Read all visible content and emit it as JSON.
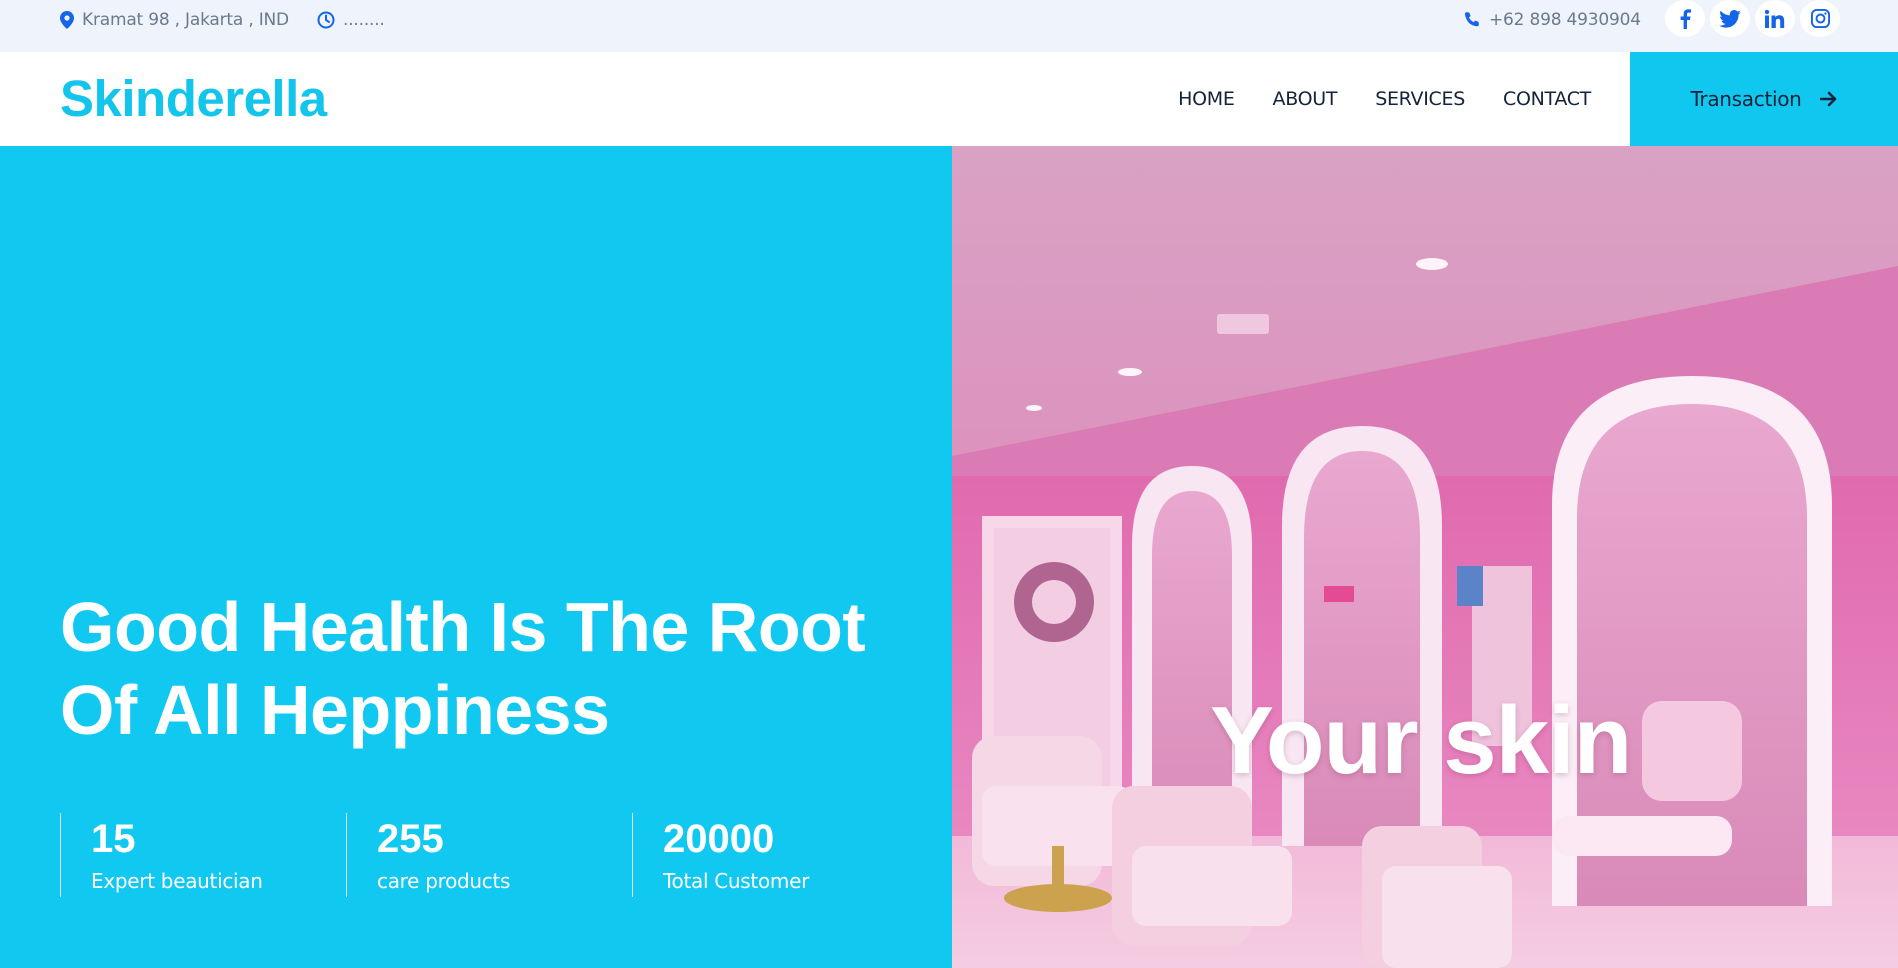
{
  "topbar": {
    "address": "Kramat 98 , Jakarta , IND",
    "hours": "........",
    "phone": "+62 898 4930904",
    "socials": [
      {
        "icon": "facebook-icon"
      },
      {
        "icon": "twitter-icon"
      },
      {
        "icon": "linkedin-icon"
      },
      {
        "icon": "instagram-icon"
      }
    ]
  },
  "navbar": {
    "brand": "Skinderella",
    "links": [
      "HOME",
      "ABOUT",
      "SERVICES",
      "CONTACT"
    ],
    "cta_label": "Transaction"
  },
  "hero": {
    "title_line1": "Good Health Is The Root",
    "title_line2": "Of All Heppiness",
    "stats": [
      {
        "value": "15",
        "label": "Expert beautician"
      },
      {
        "value": "255",
        "label": "care products"
      },
      {
        "value": "20000",
        "label": "Total Customer"
      }
    ],
    "image_caption": "Your skin"
  },
  "colors": {
    "brand": "#13c5ea",
    "hero_bg": "#10c8f0",
    "topbar_bg": "#eef3fc",
    "icon_blue": "#1565e8"
  }
}
